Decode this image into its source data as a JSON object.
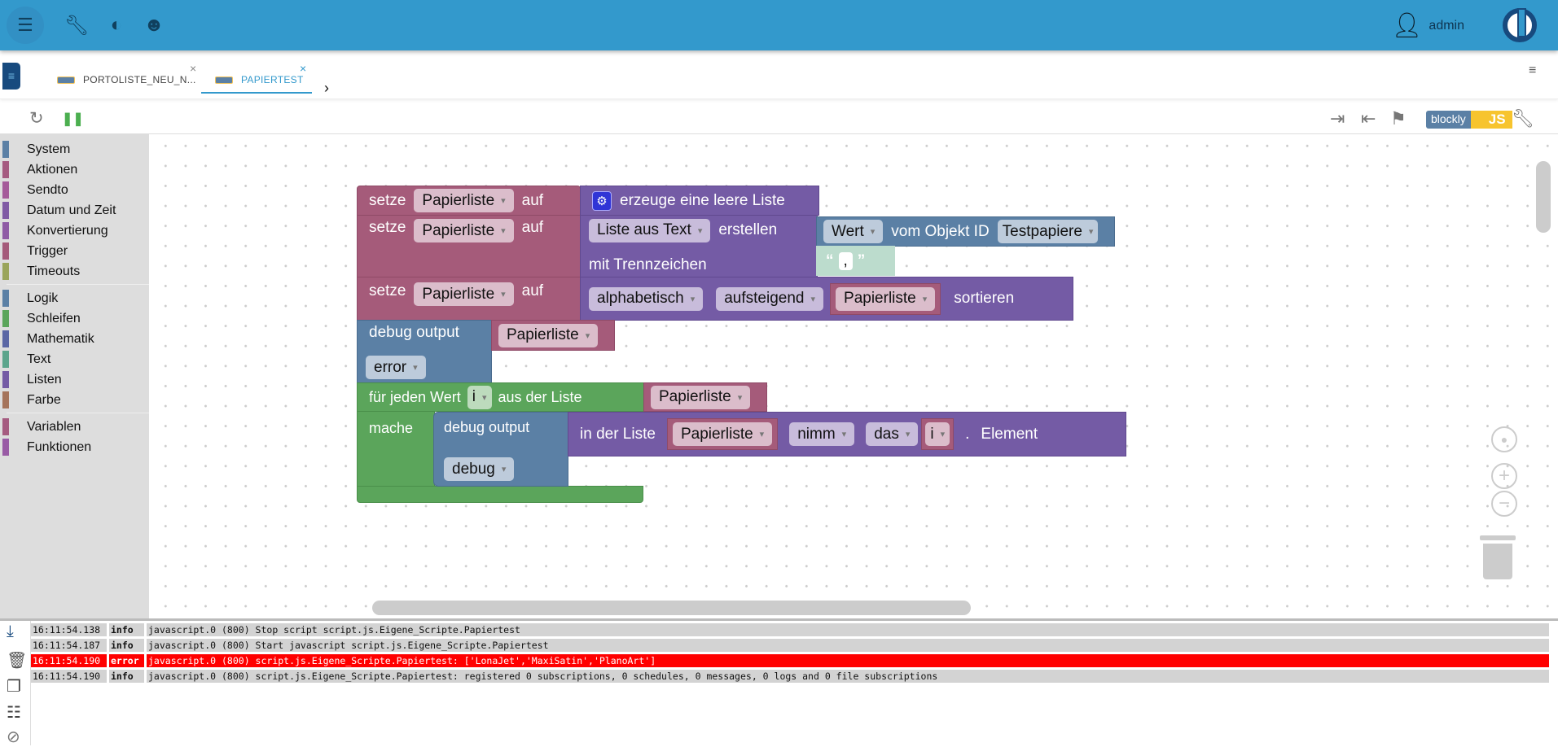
{
  "header": {
    "user": "admin",
    "icons": [
      "menu-icon",
      "wrench-icon",
      "theme-icon",
      "expert-mode-icon",
      "user-icon",
      "iobroker-logo"
    ]
  },
  "tabs": [
    {
      "label": "PORTOLISTE_NEU_N...",
      "active": false
    },
    {
      "label": "PAPIERTEST",
      "active": true
    }
  ],
  "toolbar": {
    "blockly_label": "blockly",
    "js_label": "JS",
    "icons": [
      "refresh-icon",
      "pause-icon",
      "export-icon",
      "import-icon",
      "flag-icon",
      "wrench-icon"
    ]
  },
  "colors": {
    "header": "#3399cc",
    "active_tab": "#3399cc",
    "error_row": "#ff0000",
    "js_badge": "#f7c42e"
  },
  "categories": [
    {
      "label": "System",
      "color": "#5b80a5"
    },
    {
      "label": "Aktionen",
      "color": "#a55b80"
    },
    {
      "label": "Sendto",
      "color": "#a55b9a"
    },
    {
      "label": "Datum und Zeit",
      "color": "#805ba5"
    },
    {
      "label": "Konvertierung",
      "color": "#8f5ba5"
    },
    {
      "label": "Trigger",
      "color": "#a55b7a"
    },
    {
      "label": "Timeouts",
      "color": "#9aa55b"
    },
    {
      "label": "Logik",
      "color": "#5b80a5"
    },
    {
      "label": "Schleifen",
      "color": "#5ba55b"
    },
    {
      "label": "Mathematik",
      "color": "#5b67a5"
    },
    {
      "label": "Text",
      "color": "#5ba58c"
    },
    {
      "label": "Listen",
      "color": "#745ba5"
    },
    {
      "label": "Farbe",
      "color": "#a5745b"
    },
    {
      "label": "Variablen",
      "color": "#a55b80"
    },
    {
      "label": "Funktionen",
      "color": "#995ba5"
    }
  ],
  "blocks": {
    "setze": "setze",
    "auf": "auf",
    "var": "Papierliste",
    "create_empty": "erzeuge eine leere Liste",
    "list_from_text": "Liste aus Text",
    "erstellen": "erstellen",
    "mit_trenn": "mit Trennzeichen",
    "wert": "Wert",
    "vom_objekt": "vom Objekt ID",
    "object_id": "Testpapiere",
    "delimiter": ",",
    "sort_type": "alphabetisch",
    "sort_dir": "aufsteigend",
    "sortieren": "sortieren",
    "debug_output": "debug output",
    "level_error": "error",
    "level_debug": "debug",
    "for_each": "für jeden Wert",
    "loop_var": "i",
    "aus_der_liste": "aus der Liste",
    "mache": "mache",
    "in_der_liste": "in der Liste",
    "nimm": "nimm",
    "das": "das",
    "dot": ".",
    "element": "Element"
  },
  "log": [
    {
      "time": "16:11:54.138",
      "level": "info",
      "msg": "javascript.0 (800) Stop script script.js.Eigene_Scripte.Papiertest"
    },
    {
      "time": "16:11:54.187",
      "level": "info",
      "msg": "javascript.0 (800) Start javascript script.js.Eigene_Scripte.Papiertest"
    },
    {
      "time": "16:11:54.190",
      "level": "error",
      "msg": "javascript.0 (800) script.js.Eigene_Scripte.Papiertest: ['LonaJet','MaxiSatin','PlanoArt']"
    },
    {
      "time": "16:11:54.190",
      "level": "info",
      "msg": "javascript.0 (800) script.js.Eigene_Scripte.Papiertest: registered 0 subscriptions, 0 schedules, 0 messages, 0 logs and 0 file subscriptions"
    }
  ]
}
